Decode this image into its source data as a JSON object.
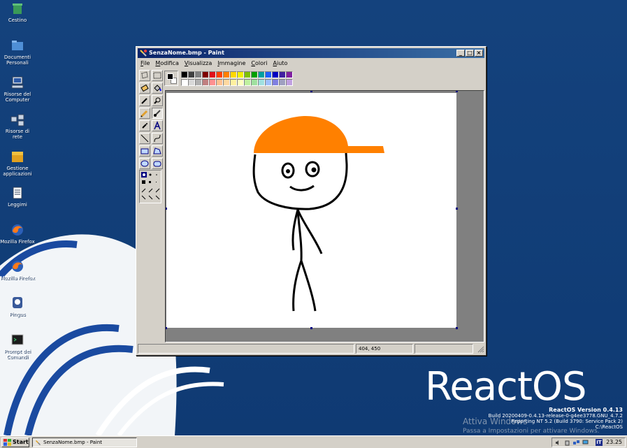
{
  "desktop": {
    "icons": [
      {
        "name": "recycle-bin",
        "label": "Cestino"
      },
      {
        "name": "my-documents",
        "label": "Documenti Personali"
      },
      {
        "name": "my-computer",
        "label": "Risorse del Computer"
      },
      {
        "name": "network",
        "label": "Risorse di rete"
      },
      {
        "name": "app-manager",
        "label": "Gestione applicazioni"
      },
      {
        "name": "readme",
        "label": "Leggimi"
      },
      {
        "name": "firefox-1",
        "label": "Mozilla Firefox"
      },
      {
        "name": "firefox-2",
        "label": "Mozilla Firefox"
      },
      {
        "name": "pingus",
        "label": "Pingus"
      },
      {
        "name": "command-prompt",
        "label": "Prompt dei Comandi"
      }
    ],
    "branding": {
      "logo_text": "ReactOS",
      "version_title": "ReactOS Version 0.4.13",
      "build": "Build 20200409-0.4.13-release-0-g4ee3778.GNU_4.7.2",
      "reporting": "Reporting NT 5.2 (Build 3790: Service Pack 2)",
      "path": "C:\\ReactOS"
    },
    "activation": {
      "line1": "Attiva Windows",
      "line2": "Passa a Impostazioni per attivare Windows."
    }
  },
  "window": {
    "title": "SenzaNome.bmp - Paint",
    "buttons": [
      "minimize",
      "maximize",
      "close"
    ],
    "menu": [
      "File",
      "Modifica",
      "Visualizza",
      "Immagine",
      "Colori",
      "Aiuto"
    ],
    "status": {
      "text": "",
      "coords": "404, 450",
      "size": ""
    }
  },
  "palette": {
    "primary": "#000000",
    "secondary": "#ffffff",
    "row1": [
      "#000000",
      "#808080",
      "#800000",
      "#808000",
      "#008000",
      "#008080",
      "#000080",
      "#800080",
      "#808040",
      "#004040",
      "#0080ff",
      "#004080",
      "#4000ff",
      "#804000"
    ],
    "row2": [
      "#ffffff",
      "#c0c0c0",
      "#ff0000",
      "#ffff00",
      "#00ff00",
      "#00ffff",
      "#0000ff",
      "#ff00ff",
      "#ffff80",
      "#00ff80",
      "#80ffff",
      "#8080ff",
      "#ff0080",
      "#ff8040"
    ],
    "display_row1": [
      "#000000",
      "#404040",
      "#808080",
      "#7f0000",
      "#e0101a",
      "#ff4000",
      "#ff8000",
      "#ffd800",
      "#f0f000",
      "#80c000",
      "#00a000",
      "#00a0a0",
      "#2060ff",
      "#0000c0",
      "#4020a0",
      "#8020a0"
    ],
    "display_row2": [
      "#ffffff",
      "#d8d8d8",
      "#b0b0b0",
      "#c08080",
      "#ff9090",
      "#ffc090",
      "#ffd8a0",
      "#fff0a0",
      "#ffffc0",
      "#c0f0a0",
      "#a0e0a0",
      "#a0e0e0",
      "#a0c0ff",
      "#8080e0",
      "#a0a0c0",
      "#c0a0e0"
    ]
  },
  "drawing": {
    "cap_color": "#ff8000",
    "ink_color": "#000000"
  },
  "taskbar": {
    "start_label": "Start",
    "task_label": "SenzaNome.bmp - Paint",
    "lang": "IT",
    "clock": "23.25"
  }
}
